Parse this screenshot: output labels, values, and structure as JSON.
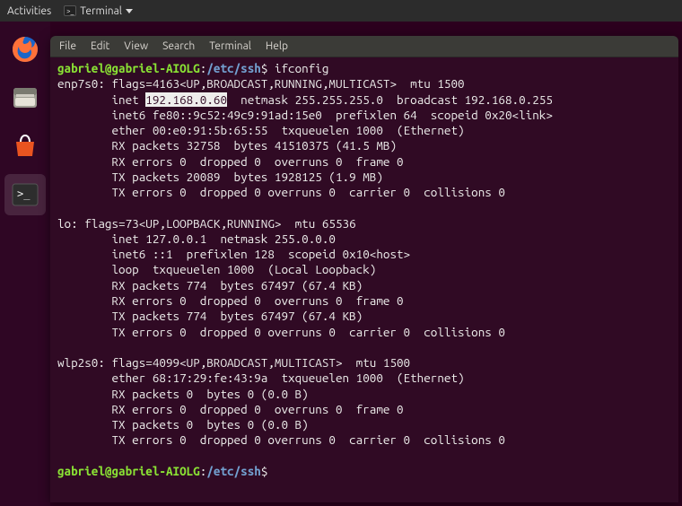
{
  "topbar": {
    "activities": "Activities",
    "app_label": "Terminal"
  },
  "launcher": {
    "items": [
      {
        "name": "firefox"
      },
      {
        "name": "files"
      },
      {
        "name": "software"
      },
      {
        "name": "terminal"
      }
    ]
  },
  "menubar": {
    "file": "File",
    "edit": "Edit",
    "view": "View",
    "search": "Search",
    "terminal": "Terminal",
    "help": "Help"
  },
  "prompt": {
    "userhost": "gabriel@gabriel-AIOLG",
    "colon": ":",
    "path": "/etc/ssh",
    "dollar": "$"
  },
  "command": "ifconfig",
  "selected_ip": "192.168.0.60",
  "lines": {
    "enp_header": "enp7s0: flags=4163<UP,BROADCAST,RUNNING,MULTICAST>  mtu 1500",
    "enp_inet_pre": "        inet ",
    "enp_inet_post": "  netmask 255.255.255.0  broadcast 192.168.0.255",
    "enp_inet6": "        inet6 fe80::9c52:49c9:91ad:15e0  prefixlen 64  scopeid 0x20<link>",
    "enp_ether": "        ether 00:e0:91:5b:65:55  txqueuelen 1000  (Ethernet)",
    "enp_rxp": "        RX packets 32758  bytes 41510375 (41.5 MB)",
    "enp_rxe": "        RX errors 0  dropped 0  overruns 0  frame 0",
    "enp_txp": "        TX packets 20089  bytes 1928125 (1.9 MB)",
    "enp_txe": "        TX errors 0  dropped 0 overruns 0  carrier 0  collisions 0",
    "lo_header": "lo: flags=73<UP,LOOPBACK,RUNNING>  mtu 65536",
    "lo_inet": "        inet 127.0.0.1  netmask 255.0.0.0",
    "lo_inet6": "        inet6 ::1  prefixlen 128  scopeid 0x10<host>",
    "lo_loop": "        loop  txqueuelen 1000  (Local Loopback)",
    "lo_rxp": "        RX packets 774  bytes 67497 (67.4 KB)",
    "lo_rxe": "        RX errors 0  dropped 0  overruns 0  frame 0",
    "lo_txp": "        TX packets 774  bytes 67497 (67.4 KB)",
    "lo_txe": "        TX errors 0  dropped 0 overruns 0  carrier 0  collisions 0",
    "wl_header": "wlp2s0: flags=4099<UP,BROADCAST,MULTICAST>  mtu 1500",
    "wl_ether": "        ether 68:17:29:fe:43:9a  txqueuelen 1000  (Ethernet)",
    "wl_rxp": "        RX packets 0  bytes 0 (0.0 B)",
    "wl_rxe": "        RX errors 0  dropped 0  overruns 0  frame 0",
    "wl_txp": "        TX packets 0  bytes 0 (0.0 B)",
    "wl_txe": "        TX errors 0  dropped 0 overruns 0  carrier 0  collisions 0"
  }
}
